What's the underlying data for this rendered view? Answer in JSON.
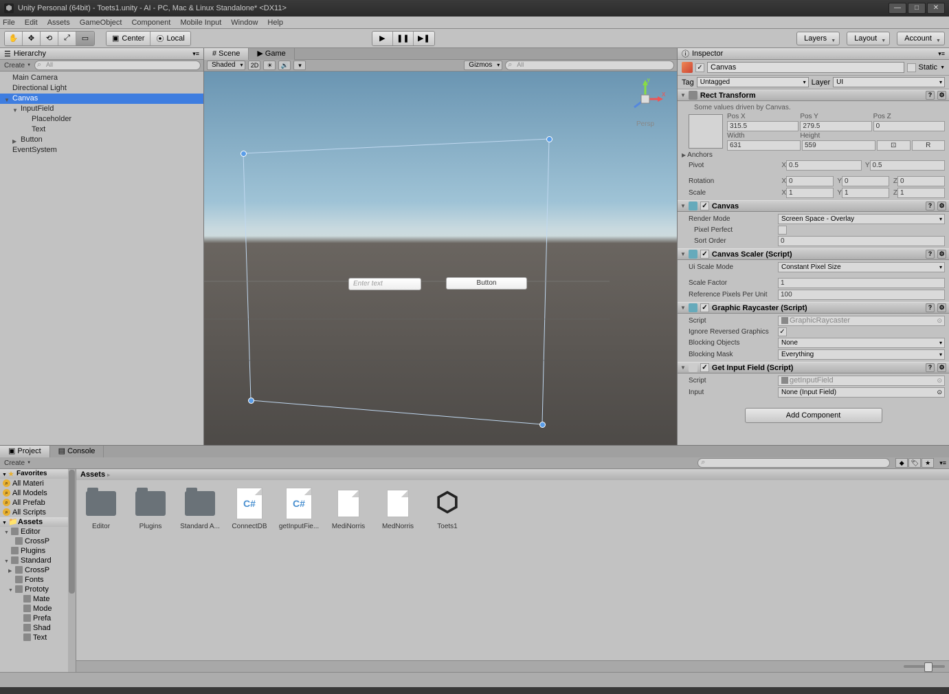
{
  "title": "Unity Personal (64bit) - Toets1.unity - AI - PC, Mac & Linux Standalone* <DX11>",
  "menu": {
    "file": "File",
    "edit": "Edit",
    "assets": "Assets",
    "gameobject": "GameObject",
    "component": "Component",
    "mobileinput": "Mobile Input",
    "window": "Window",
    "help": "Help"
  },
  "toolbar": {
    "center": "Center",
    "local": "Local",
    "layers": "Layers",
    "layout": "Layout",
    "account": "Account"
  },
  "hierarchy": {
    "title": "Hierarchy",
    "create": "Create",
    "search_placeholder": "All",
    "items": [
      "Main Camera",
      "Directional Light",
      "Canvas",
      "InputField",
      "Placeholder",
      "Text",
      "Button",
      "EventSystem"
    ]
  },
  "scene": {
    "tab_scene": "Scene",
    "tab_game": "Game",
    "shaded": "Shaded",
    "mode2d": "2D",
    "gizmos": "Gizmos",
    "search_placeholder": "All",
    "persp": "Persp",
    "input_placeholder": "Enter text",
    "button_label": "Button"
  },
  "inspector": {
    "title": "Inspector",
    "name": "Canvas",
    "static": "Static",
    "tag_lbl": "Tag",
    "tag_val": "Untagged",
    "layer_lbl": "Layer",
    "layer_val": "UI",
    "rect": {
      "title": "Rect Transform",
      "info": "Some values driven by Canvas.",
      "posx_lbl": "Pos X",
      "posy_lbl": "Pos Y",
      "posz_lbl": "Pos Z",
      "posx": "315.5",
      "posy": "279.5",
      "posz": "0",
      "w_lbl": "Width",
      "h_lbl": "Height",
      "reset": "R",
      "w": "631",
      "h": "559",
      "anchors": "Anchors",
      "pivot": "Pivot",
      "pivot_x": "0.5",
      "pivot_y": "0.5",
      "rotation": "Rotation",
      "rot_x": "0",
      "rot_y": "0",
      "rot_z": "0",
      "scale": "Scale",
      "scl_x": "1",
      "scl_y": "1",
      "scl_z": "1"
    },
    "canvas": {
      "title": "Canvas",
      "render_lbl": "Render Mode",
      "render_val": "Screen Space - Overlay",
      "pixel_lbl": "Pixel Perfect",
      "sort_lbl": "Sort Order",
      "sort_val": "0"
    },
    "scaler": {
      "title": "Canvas Scaler (Script)",
      "mode_lbl": "Ui Scale Mode",
      "mode_val": "Constant Pixel Size",
      "factor_lbl": "Scale Factor",
      "factor_val": "1",
      "refpx_lbl": "Reference Pixels Per Unit",
      "refpx_val": "100"
    },
    "raycaster": {
      "title": "Graphic Raycaster (Script)",
      "script_lbl": "Script",
      "script_val": "GraphicRaycaster",
      "ignore_lbl": "Ignore Reversed Graphics",
      "blockobj_lbl": "Blocking Objects",
      "blockobj_val": "None",
      "blockmask_lbl": "Blocking Mask",
      "blockmask_val": "Everything"
    },
    "getinput": {
      "title": "Get Input Field (Script)",
      "script_lbl": "Script",
      "script_val": "getInputField",
      "input_lbl": "Input",
      "input_val": "None (Input Field)"
    },
    "add_btn": "Add Component"
  },
  "project": {
    "tab_project": "Project",
    "tab_console": "Console",
    "create": "Create",
    "favorites": "Favorites",
    "fav_items": [
      "All Materi",
      "All Models",
      "All Prefab",
      "All Scripts"
    ],
    "assets_root": "Assets",
    "tree": [
      "Editor",
      "CrossP",
      "Plugins",
      "Standard",
      "CrossP",
      "Fonts",
      "Prototy",
      "Mate",
      "Mode",
      "Prefa",
      "Shad",
      "Text"
    ],
    "breadcrumb": "Assets",
    "items": [
      {
        "type": "folder",
        "label": "Editor"
      },
      {
        "type": "folder",
        "label": "Plugins"
      },
      {
        "type": "folder",
        "label": "Standard A..."
      },
      {
        "type": "cs",
        "label": "ConnectDB"
      },
      {
        "type": "cs",
        "label": "getInputFie..."
      },
      {
        "type": "file",
        "label": "MediNorris"
      },
      {
        "type": "file",
        "label": "MedNorris"
      },
      {
        "type": "unity",
        "label": "Toets1"
      }
    ]
  }
}
